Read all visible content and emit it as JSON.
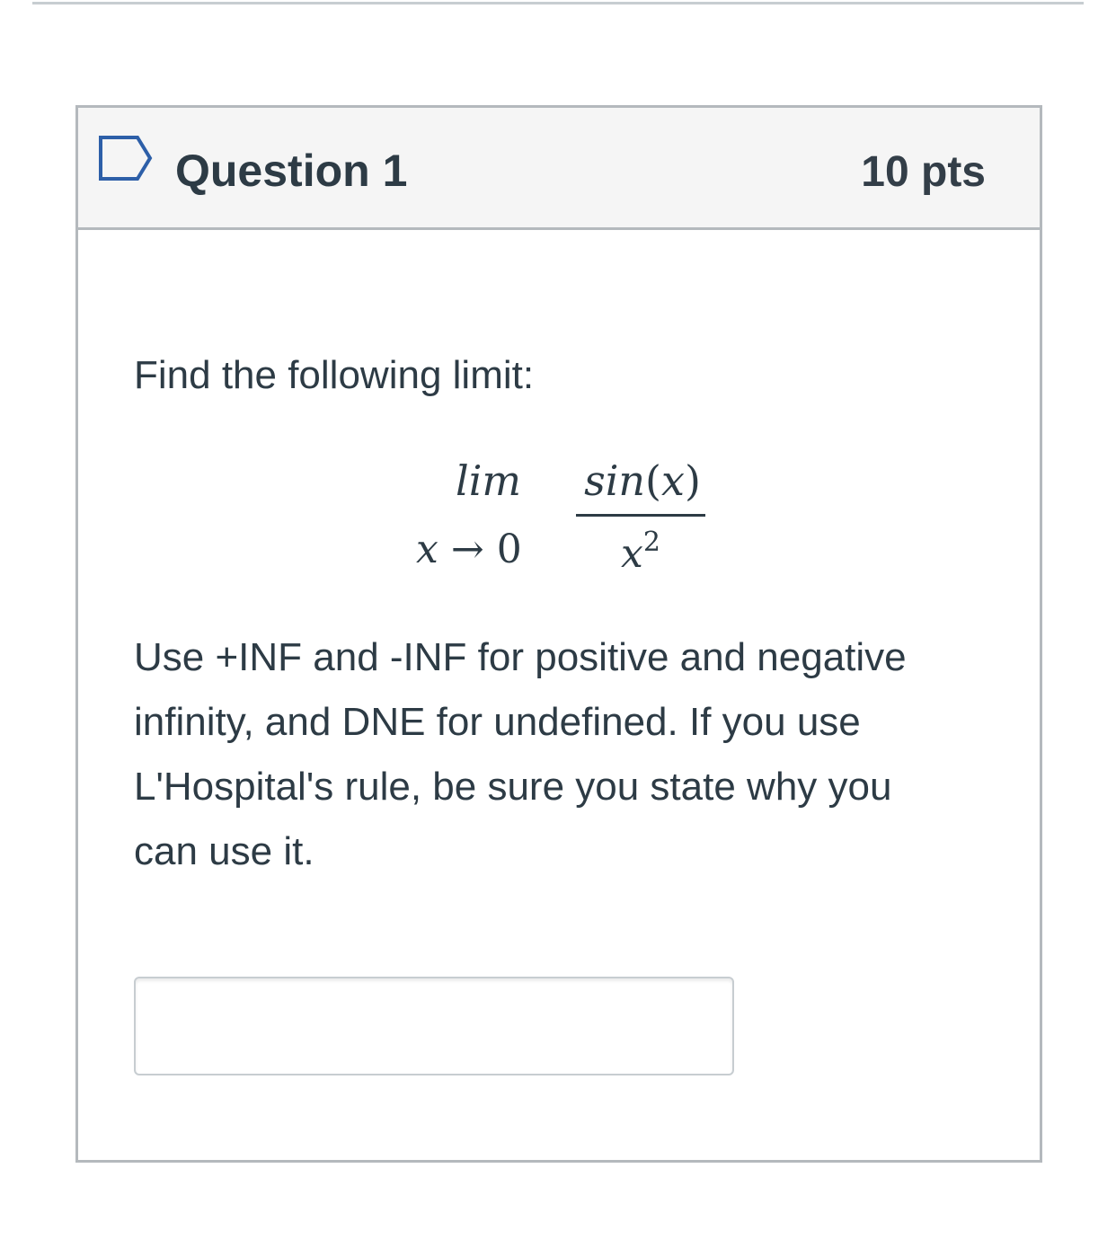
{
  "question": {
    "title": "Question 1",
    "points": "10 pts",
    "flag_icon": "bookmark-flag-icon",
    "prompt": "Find the following limit:",
    "formula": {
      "lim": "lim",
      "sub_var": "x",
      "sub_arrow": "→",
      "sub_value": "0",
      "num_func": "sin",
      "num_open": "(",
      "num_var": "x",
      "num_close": ")",
      "den_base": "x",
      "den_exp": "2"
    },
    "instructions_lines": [
      "Use +INF and -INF for positive and negative",
      "infinity, and DNE for undefined.  If you use",
      "L'Hospital's rule, be sure you state why you",
      "can use it."
    ],
    "answer": {
      "value": "",
      "placeholder": ""
    }
  },
  "colors": {
    "text": "#2d3b45",
    "header_bg": "#f5f5f5",
    "border": "#b4b9bd"
  }
}
